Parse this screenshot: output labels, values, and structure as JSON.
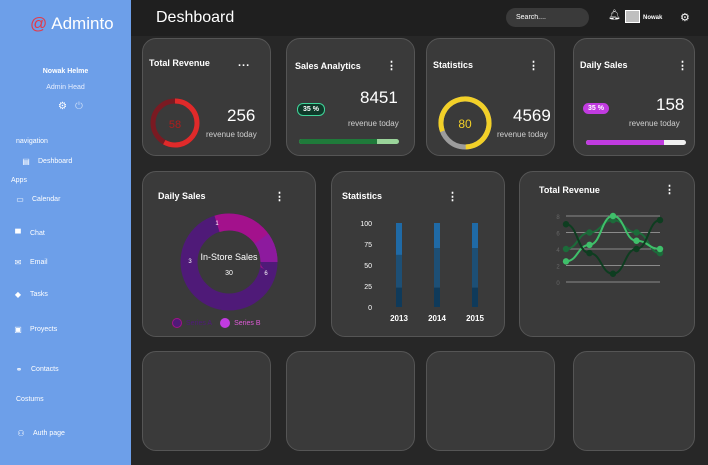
{
  "sidebar": {
    "brand": "Adminto",
    "brand_icon": "@",
    "user_name": "Nowak Helme",
    "user_role": "Admin Head",
    "sections": {
      "navigation": "navigation",
      "apps": "Apps",
      "custom": "Costums"
    },
    "items": {
      "dashboard": "Deshboard",
      "calendar": "Calendar",
      "chat": "Chat",
      "email": "Email",
      "tasks": "Tasks",
      "projects": "Proyects",
      "contacts": "Contacts",
      "auth": "Auth page"
    }
  },
  "header": {
    "title": "Deshboard",
    "search_placeholder": "Search....",
    "user": "Nowak"
  },
  "cards": {
    "total_revenue": {
      "title": "Total Revenue",
      "menu": "...",
      "gauge": "58",
      "value": "256",
      "sub": "revenue today",
      "gauge_percent": 58
    },
    "sales_analytics": {
      "title": "Sales Analytics",
      "menu": "⋮",
      "badge": "35 %",
      "value": "8451",
      "sub": "revenue today",
      "progress": 0.78
    },
    "statistics": {
      "title": "Statistics",
      "menu": "⋮",
      "gauge": "80",
      "value": "4569",
      "sub": "revenue today",
      "gauge_percent": 80
    },
    "daily_sales": {
      "title": "Daily Sales",
      "menu": "⋮",
      "badge": "35 %",
      "value": "158",
      "sub": "revenue today",
      "progress": 0.78
    }
  },
  "donut": {
    "title": "Daily Sales",
    "menu": "⋮",
    "center_label": "In-Store Sales",
    "center_value": "30",
    "segment_labels": [
      "1",
      "3",
      "6"
    ],
    "legend": [
      "Series A",
      "Series B"
    ]
  },
  "statistics_chart": {
    "title": "Statistics",
    "menu": "⋮"
  },
  "revenue_chart": {
    "title": "Total Revenue",
    "menu": "⋮"
  },
  "colors": {
    "sidebar": "#6d9fe9",
    "accent_red": "#e23b4b",
    "green": "#2e9e5e",
    "magenta": "#c13be0",
    "purple_dark": "#4f1a78",
    "purple_light": "#a3118c",
    "blue": "#1f6aa6"
  },
  "chart_data": [
    {
      "type": "bar",
      "categories": [
        "2013",
        "2014",
        "2015"
      ],
      "series": [
        {
          "values": [
            23,
            23,
            23
          ]
        },
        {
          "values": [
            62,
            70,
            70
          ]
        },
        {
          "values": [
            100,
            100,
            100
          ]
        }
      ],
      "ylim": [
        0,
        100
      ],
      "yticks": [
        "100",
        "75",
        "50",
        "25",
        "0"
      ]
    },
    {
      "type": "line",
      "x": [
        0,
        1,
        2,
        3,
        4
      ],
      "series": [
        {
          "values": [
            4,
            6,
            7.5,
            6,
            3.5
          ]
        },
        {
          "values": [
            2.5,
            4.5,
            8,
            5,
            4
          ]
        },
        {
          "values": [
            7,
            3.5,
            1,
            4,
            7.5
          ]
        }
      ],
      "ylim": [
        0,
        8
      ],
      "yticks": [
        "8",
        "6",
        "4",
        "2",
        "0"
      ]
    }
  ]
}
